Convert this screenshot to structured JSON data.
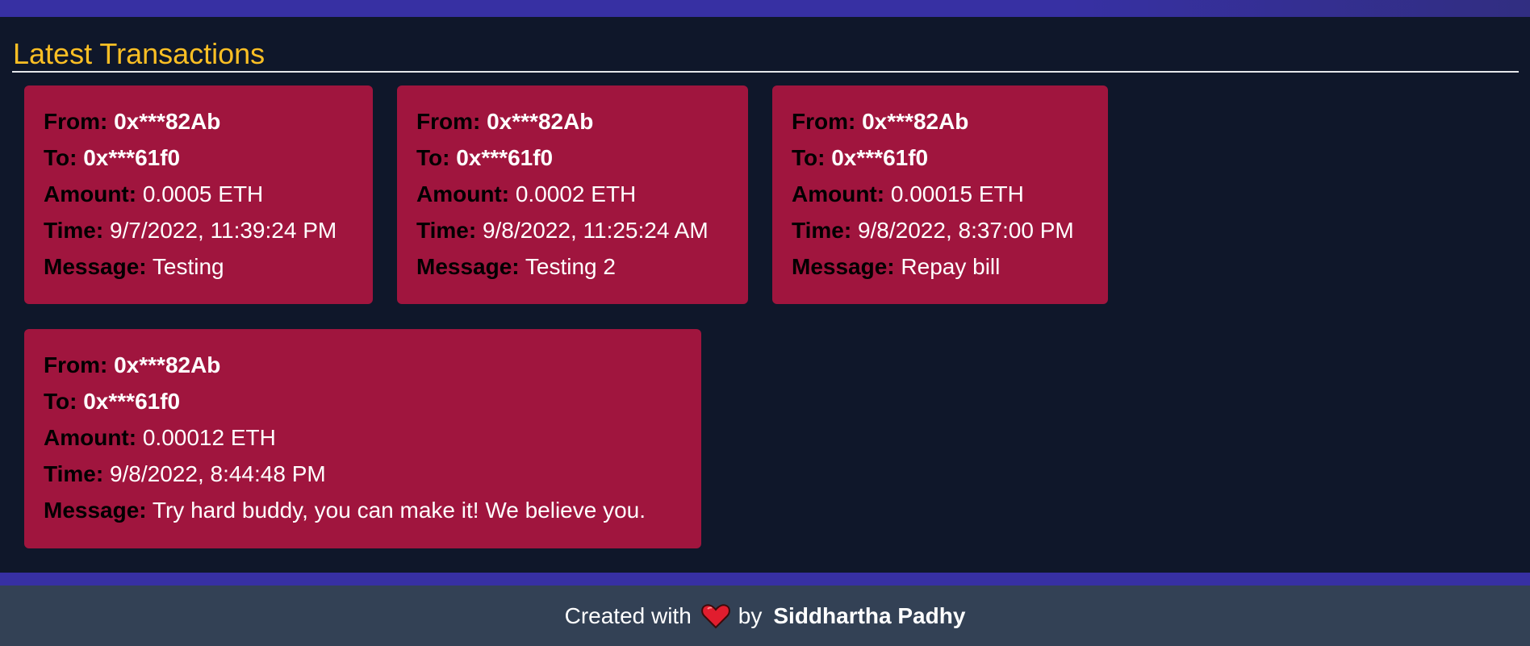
{
  "section": {
    "title": "Latest Transactions"
  },
  "labels": {
    "from": "From:",
    "to": "To:",
    "amount": "Amount:",
    "time": "Time:",
    "message": "Message:"
  },
  "transactions": [
    {
      "from": "0x***82Ab",
      "to": "0x***61f0",
      "amount": "0.0005 ETH",
      "time": "9/7/2022, 11:39:24 PM",
      "message": "Testing"
    },
    {
      "from": "0x***82Ab",
      "to": "0x***61f0",
      "amount": "0.0002 ETH",
      "time": "9/8/2022, 11:25:24 AM",
      "message": "Testing 2"
    },
    {
      "from": "0x***82Ab",
      "to": "0x***61f0",
      "amount": "0.00015 ETH",
      "time": "9/8/2022, 8:37:00 PM",
      "message": "Repay bill"
    },
    {
      "from": "0x***82Ab",
      "to": "0x***61f0",
      "amount": "0.00012 ETH",
      "time": "9/8/2022, 8:44:48 PM",
      "message": "Try hard buddy, you can make it! We believe you."
    }
  ],
  "footer": {
    "created_with": "Created with",
    "heart_icon": "heart-icon",
    "by": "by",
    "author": "Siddhartha Padhy"
  },
  "colors": {
    "page_bg": "#0f172a",
    "accent_bar": "#3730a3",
    "title": "#fbbf24",
    "card": "#a0153e",
    "footer_bg": "#334155",
    "heart": "#e11d2e"
  }
}
